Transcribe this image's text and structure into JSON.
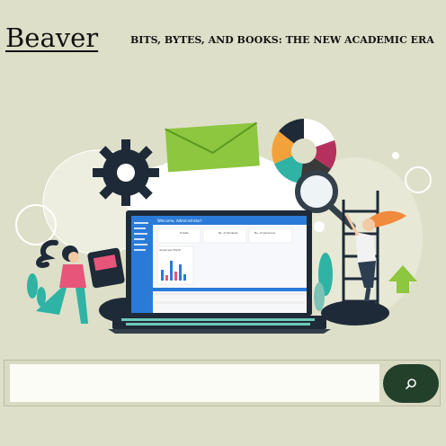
{
  "header": {
    "brand": "Beaver",
    "tagline": "BITS, BYTES, AND BOOKS: THE NEW ACADEMIC ERA"
  },
  "hero": {
    "dashboard_title": "Welcome, Administrator!",
    "stat_cards": [
      "Tickets",
      "No. of Students",
      "No. of Librarians"
    ],
    "chart_caption": "Issued per Month"
  },
  "search": {
    "placeholder": "",
    "button_icon": "search-icon"
  },
  "colors": {
    "background": "#dedfc8",
    "button": "#23402b",
    "accent_blue": "#2a7bd8",
    "accent_orange": "#f08a3c",
    "accent_teal": "#2fb3a4",
    "accent_pink": "#e8557a"
  }
}
